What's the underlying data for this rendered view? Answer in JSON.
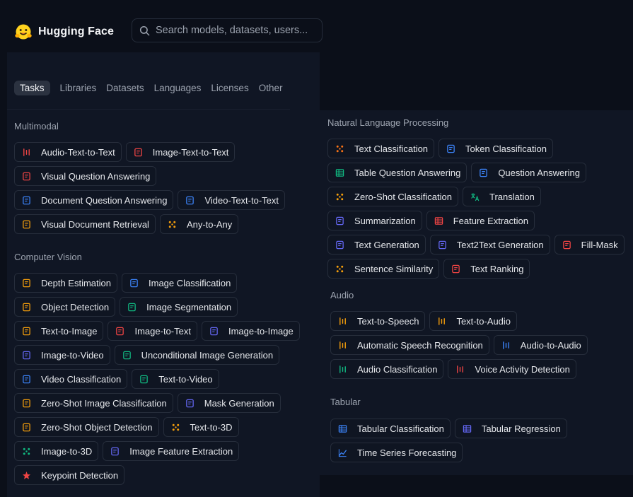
{
  "brand": {
    "name": "Hugging Face"
  },
  "search": {
    "placeholder": "Search models, datasets, users..."
  },
  "tabs": [
    "Tasks",
    "Libraries",
    "Datasets",
    "Languages",
    "Licenses",
    "Other"
  ],
  "active_tab": "Tasks",
  "colors": {
    "background": "#0b0f19",
    "panel": "#101624",
    "chip_border": "#262d3b"
  },
  "sections": {
    "multimodal": {
      "title": "Multimodal",
      "items": [
        {
          "label": "Audio-Text-to-Text",
          "icon": "audio-text-icon",
          "color": "#ef4444"
        },
        {
          "label": "Image-Text-to-Text",
          "icon": "image-text-icon",
          "color": "#ef4444"
        },
        {
          "label": "Visual Question Answering",
          "icon": "visual-qa-icon",
          "color": "#ef4444"
        },
        {
          "label": "Document Question Answering",
          "icon": "document-qa-icon",
          "color": "#3b82f6"
        },
        {
          "label": "Video-Text-to-Text",
          "icon": "video-text-icon",
          "color": "#3b82f6"
        },
        {
          "label": "Visual Document Retrieval",
          "icon": "document-retrieval-icon",
          "color": "#f59e0b"
        },
        {
          "label": "Any-to-Any",
          "icon": "any-to-any-icon",
          "color": "#f59e0b"
        }
      ]
    },
    "computer_vision": {
      "title": "Computer Vision",
      "items": [
        {
          "label": "Depth Estimation",
          "icon": "depth-icon",
          "color": "#f59e0b"
        },
        {
          "label": "Image Classification",
          "icon": "image-classification-icon",
          "color": "#3b82f6"
        },
        {
          "label": "Object Detection",
          "icon": "object-detection-icon",
          "color": "#f59e0b"
        },
        {
          "label": "Image Segmentation",
          "icon": "image-segmentation-icon",
          "color": "#10b981"
        },
        {
          "label": "Text-to-Image",
          "icon": "text-to-image-icon",
          "color": "#f59e0b"
        },
        {
          "label": "Image-to-Text",
          "icon": "image-to-text-icon",
          "color": "#ef4444"
        },
        {
          "label": "Image-to-Image",
          "icon": "image-to-image-icon",
          "color": "#6366f1"
        },
        {
          "label": "Image-to-Video",
          "icon": "image-to-video-icon",
          "color": "#6366f1"
        },
        {
          "label": "Unconditional Image Generation",
          "icon": "unconditional-generation-icon",
          "color": "#10b981"
        },
        {
          "label": "Video Classification",
          "icon": "video-classification-icon",
          "color": "#3b82f6"
        },
        {
          "label": "Text-to-Video",
          "icon": "text-to-video-icon",
          "color": "#10b981"
        },
        {
          "label": "Zero-Shot Image Classification",
          "icon": "zero-shot-image-icon",
          "color": "#f59e0b"
        },
        {
          "label": "Mask Generation",
          "icon": "mask-generation-icon",
          "color": "#6366f1"
        },
        {
          "label": "Zero-Shot Object Detection",
          "icon": "zero-shot-object-icon",
          "color": "#f59e0b"
        },
        {
          "label": "Text-to-3D",
          "icon": "text-to-3d-icon",
          "color": "#f59e0b"
        },
        {
          "label": "Image-to-3D",
          "icon": "image-to-3d-icon",
          "color": "#10b981"
        },
        {
          "label": "Image Feature Extraction",
          "icon": "image-feature-icon",
          "color": "#6366f1"
        },
        {
          "label": "Keypoint Detection",
          "icon": "keypoint-icon",
          "color": "#ef4444"
        }
      ]
    },
    "nlp": {
      "title": "Natural Language Processing",
      "items": [
        {
          "label": "Text Classification",
          "icon": "text-classification-icon",
          "color": "#f97316"
        },
        {
          "label": "Token Classification",
          "icon": "token-classification-icon",
          "color": "#3b82f6"
        },
        {
          "label": "Table Question Answering",
          "icon": "table-qa-icon",
          "color": "#10b981"
        },
        {
          "label": "Question Answering",
          "icon": "question-answering-icon",
          "color": "#3b82f6"
        },
        {
          "label": "Zero-Shot Classification",
          "icon": "zero-shot-classification-icon",
          "color": "#f59e0b"
        },
        {
          "label": "Translation",
          "icon": "translation-icon",
          "color": "#10b981"
        },
        {
          "label": "Summarization",
          "icon": "summarization-icon",
          "color": "#6366f1"
        },
        {
          "label": "Feature Extraction",
          "icon": "feature-extraction-icon",
          "color": "#ef4444"
        },
        {
          "label": "Text Generation",
          "icon": "text-generation-icon",
          "color": "#6366f1"
        },
        {
          "label": "Text2Text Generation",
          "icon": "text2text-icon",
          "color": "#6366f1"
        },
        {
          "label": "Fill-Mask",
          "icon": "fill-mask-icon",
          "color": "#ef4444"
        },
        {
          "label": "Sentence Similarity",
          "icon": "sentence-similarity-icon",
          "color": "#f59e0b"
        },
        {
          "label": "Text Ranking",
          "icon": "text-ranking-icon",
          "color": "#ef4444"
        }
      ]
    },
    "audio": {
      "title": "Audio",
      "items": [
        {
          "label": "Text-to-Speech",
          "icon": "text-to-speech-icon",
          "color": "#f59e0b"
        },
        {
          "label": "Text-to-Audio",
          "icon": "text-to-audio-icon",
          "color": "#f59e0b"
        },
        {
          "label": "Automatic Speech Recognition",
          "icon": "speech-recognition-icon",
          "color": "#f59e0b"
        },
        {
          "label": "Audio-to-Audio",
          "icon": "audio-to-audio-icon",
          "color": "#3b82f6"
        },
        {
          "label": "Audio Classification",
          "icon": "audio-classification-icon",
          "color": "#10b981"
        },
        {
          "label": "Voice Activity Detection",
          "icon": "voice-activity-icon",
          "color": "#ef4444"
        }
      ]
    },
    "tabular": {
      "title": "Tabular",
      "items": [
        {
          "label": "Tabular Classification",
          "icon": "tabular-classification-icon",
          "color": "#3b82f6"
        },
        {
          "label": "Tabular Regression",
          "icon": "tabular-regression-icon",
          "color": "#6366f1"
        },
        {
          "label": "Time Series Forecasting",
          "icon": "time-series-icon",
          "color": "#3b82f6"
        }
      ]
    }
  }
}
